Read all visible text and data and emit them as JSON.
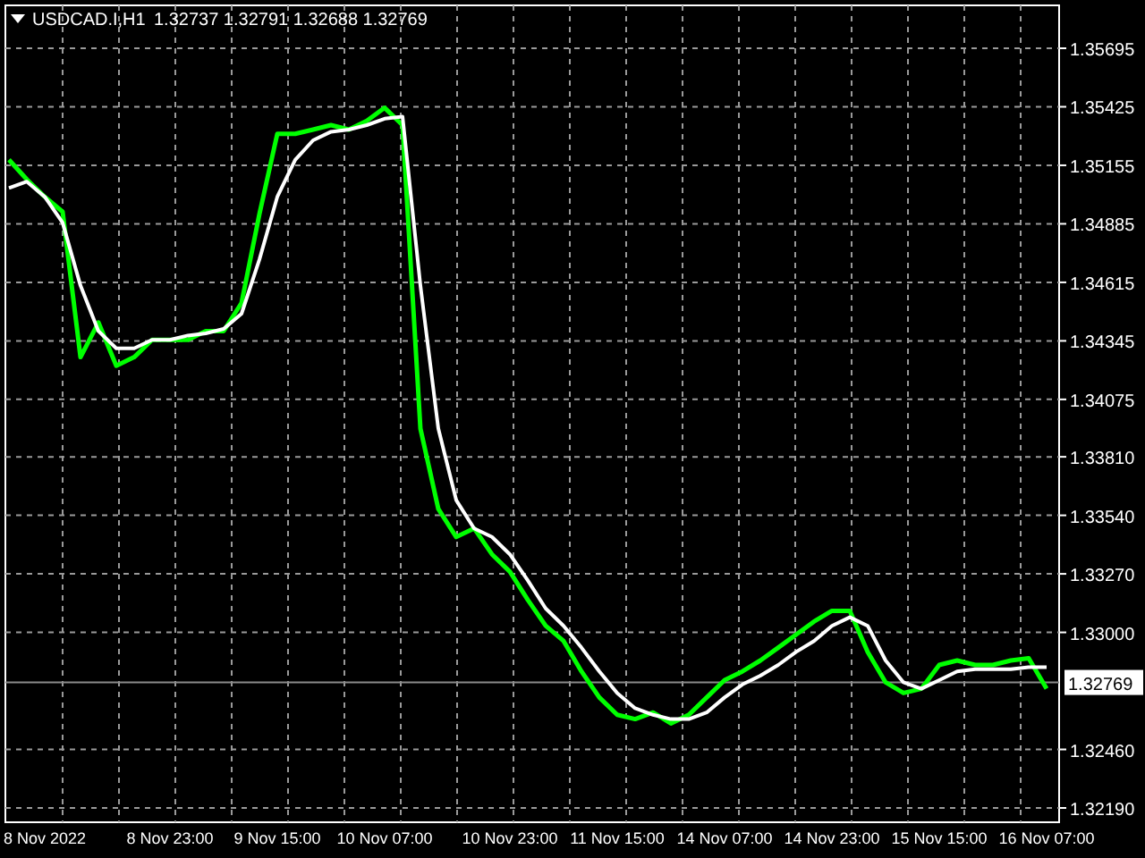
{
  "chart": {
    "quote": "1.32737 1.32791 1.32688 1.32769",
    "last_price_label": "1.32769",
    "chart_data": {
      "type": "line",
      "categories": [
        null,
        null,
        "8 Nov 2022",
        null,
        null,
        null,
        null,
        null,
        null,
        "8 Nov 23:00",
        null,
        null,
        null,
        null,
        null,
        "9 Nov 15:00",
        null,
        null,
        null,
        null,
        null,
        "10 Nov 07:00",
        null,
        null,
        null,
        null,
        null,
        null,
        "10 Nov 23:00",
        null,
        null,
        null,
        null,
        null,
        "11 Nov 15:00",
        null,
        null,
        null,
        null,
        null,
        "14 Nov 07:00",
        null,
        null,
        null,
        null,
        null,
        "14 Nov 23:00",
        null,
        null,
        null,
        null,
        null,
        "15 Nov 15:00",
        null,
        null,
        null,
        null,
        null,
        "16 Nov 07:00"
      ],
      "grid": true,
      "ref_lines": [
        {
          "axis": "y",
          "value": 1.32769
        }
      ],
      "series": [
        {
          "name": "USDCAD.I,H1",
          "color": "#00ff00",
          "values": [
            1.3518,
            1.3509,
            1.3501,
            1.3494,
            1.3427,
            1.3443,
            1.3423,
            1.3427,
            1.3435,
            1.3435,
            1.3435,
            1.3439,
            1.3439,
            1.3452,
            1.3493,
            1.353,
            1.353,
            1.3532,
            1.3534,
            1.3532,
            1.3536,
            1.3542,
            1.3534,
            1.3394,
            1.3357,
            1.3344,
            1.3348,
            1.3336,
            1.3328,
            1.3315,
            1.3303,
            1.3296,
            1.3282,
            1.327,
            1.3262,
            1.326,
            1.3263,
            1.3258,
            1.3262,
            1.327,
            1.3278,
            1.3282,
            1.3287,
            1.3293,
            1.3299,
            1.3305,
            1.331,
            1.331,
            1.3291,
            1.3277,
            1.3272,
            1.3274,
            1.3285,
            1.3287,
            1.3285,
            1.3285,
            1.3287,
            1.3288,
            1.3274
          ]
        },
        {
          "color": "#ffffff",
          "values": [
            1.3505,
            1.3508,
            1.3501,
            1.3489,
            1.346,
            1.3439,
            1.3431,
            1.3431,
            1.3435,
            1.3435,
            1.3437,
            1.3438,
            1.344,
            1.3447,
            1.3472,
            1.3501,
            1.3518,
            1.3527,
            1.3531,
            1.3532,
            1.3534,
            1.3537,
            1.3538,
            1.346,
            1.3394,
            1.3361,
            1.3348,
            1.3344,
            1.3336,
            1.3324,
            1.3311,
            1.3303,
            1.3293,
            1.3282,
            1.3272,
            1.3265,
            1.3262,
            1.326,
            1.326,
            1.3263,
            1.327,
            1.3276,
            1.328,
            1.3285,
            1.3291,
            1.3296,
            1.3303,
            1.3307,
            1.3303,
            1.3287,
            1.3277,
            1.3274,
            1.3278,
            1.3282,
            1.3283,
            1.3283,
            1.3283,
            1.3284,
            1.3284
          ]
        }
      ],
      "ylim": [
        1.3219,
        1.35695
      ],
      "yticks": [
        {
          "value": 1.35695,
          "label": "1.35695"
        },
        {
          "value": 1.35425,
          "label": "1.35425"
        },
        {
          "value": 1.35155,
          "label": "1.35155"
        },
        {
          "value": 1.34885,
          "label": "1.34885"
        },
        {
          "value": 1.34615,
          "label": "1.34615"
        },
        {
          "value": 1.34345,
          "label": "1.34345"
        },
        {
          "value": 1.34075,
          "label": "1.34075"
        },
        {
          "value": 1.3381,
          "label": "1.33810"
        },
        {
          "value": 1.3354,
          "label": "1.33540"
        },
        {
          "value": 1.3327,
          "label": "1.33270"
        },
        {
          "value": 1.33,
          "label": "1.33000"
        },
        {
          "value": 1.3246,
          "label": "1.32460"
        },
        {
          "value": 1.3219,
          "label": "1.32190"
        }
      ]
    }
  }
}
